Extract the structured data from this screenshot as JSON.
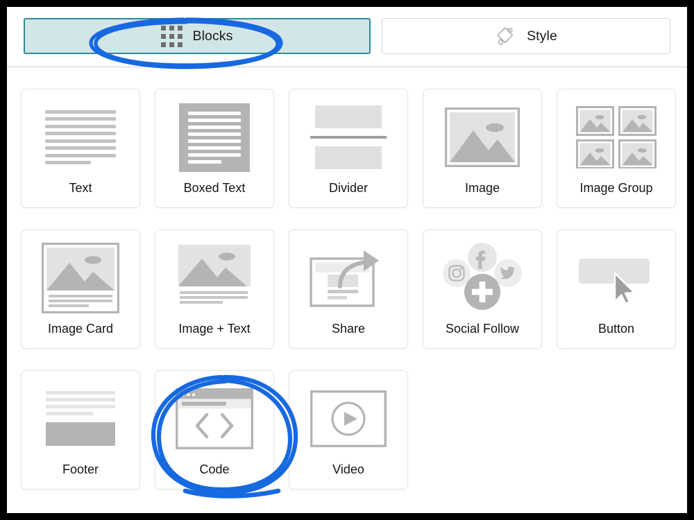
{
  "window": {
    "title": "Block Picker",
    "background": "#ffffff",
    "outer_border_color": "#000000"
  },
  "tabs": {
    "active": "Blocks",
    "items": [
      {
        "id": "blocks",
        "label": "Blocks",
        "icon": "grid-icon",
        "active": true,
        "bg": "#d3e6e7",
        "border": "#2d8a96"
      },
      {
        "id": "style",
        "label": "Style",
        "icon": "paint-bucket-icon",
        "active": false,
        "bg": "#ffffff",
        "border": "#d6d6d6"
      }
    ]
  },
  "blocks": [
    {
      "id": "text",
      "label": "Text",
      "icon": "text-lines-icon"
    },
    {
      "id": "boxed-text",
      "label": "Boxed Text",
      "icon": "boxed-text-icon"
    },
    {
      "id": "divider",
      "label": "Divider",
      "icon": "divider-icon"
    },
    {
      "id": "image",
      "label": "Image",
      "icon": "image-icon"
    },
    {
      "id": "image-group",
      "label": "Image Group",
      "icon": "image-group-icon"
    },
    {
      "id": "image-card",
      "label": "Image Card",
      "icon": "image-card-icon"
    },
    {
      "id": "image-text",
      "label": "Image + Text",
      "icon": "image-text-icon"
    },
    {
      "id": "share",
      "label": "Share",
      "icon": "share-arrow-icon"
    },
    {
      "id": "social-follow",
      "label": "Social Follow",
      "icon": "social-follow-icon"
    },
    {
      "id": "button",
      "label": "Button",
      "icon": "button-cursor-icon"
    },
    {
      "id": "footer",
      "label": "Footer",
      "icon": "footer-icon"
    },
    {
      "id": "code",
      "label": "Code",
      "icon": "code-window-icon"
    },
    {
      "id": "video",
      "label": "Video",
      "icon": "video-play-icon"
    }
  ],
  "annotations": {
    "color": "#1769e0",
    "items": [
      {
        "id": "annot-blocks",
        "target": "Blocks",
        "shape": "double-ellipse"
      },
      {
        "id": "annot-code",
        "target": "Code",
        "shape": "double-ellipse"
      }
    ]
  },
  "social_icons": {
    "facebook": "f",
    "instagram": "instagram-icon",
    "twitter": "twitter-icon",
    "plus": "plus-icon"
  },
  "palette": {
    "art_gray": "#b4b4b4",
    "art_light": "#e0e0e0",
    "art_mid": "#c8c8c8",
    "card_border": "#e3e3e3",
    "text": "#151515"
  }
}
